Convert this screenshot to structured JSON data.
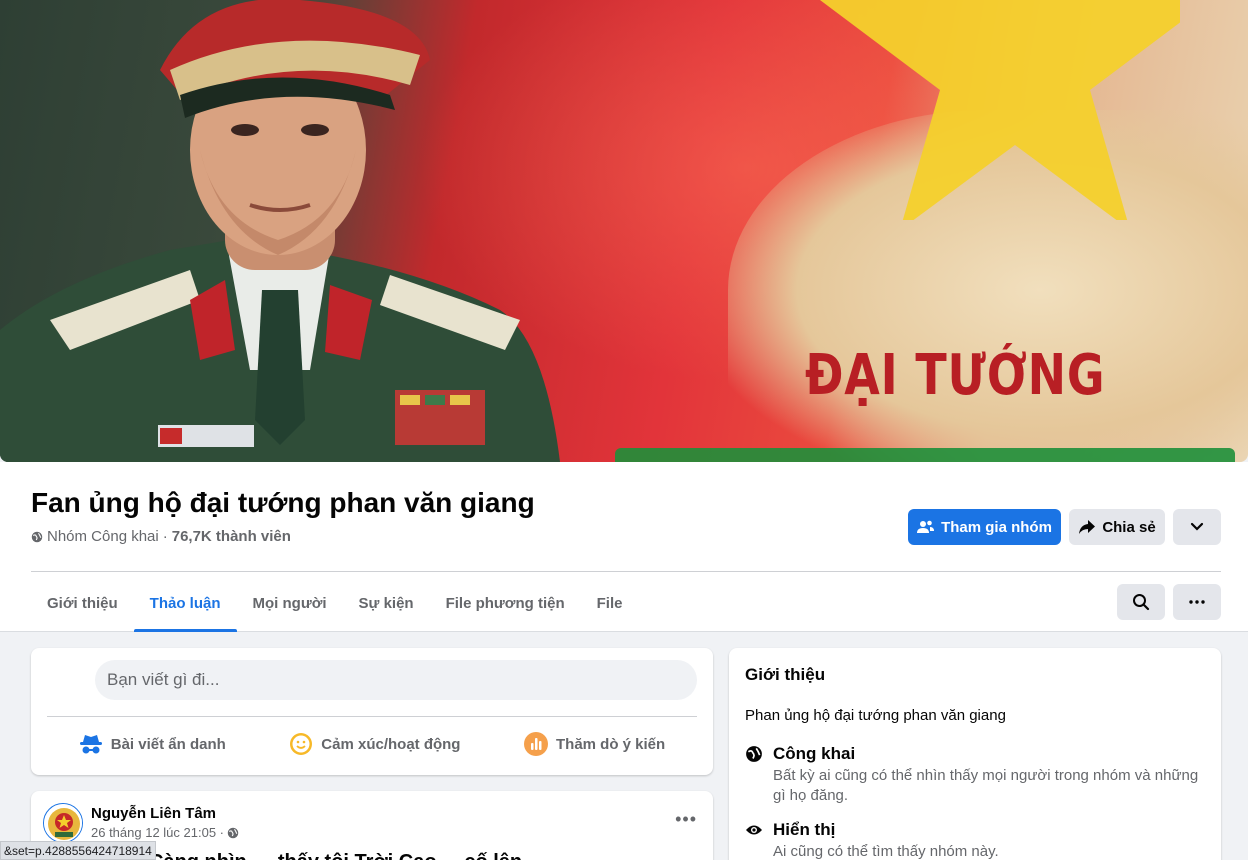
{
  "cover": {
    "text_line1": "ĐẠI TƯỚNG"
  },
  "group": {
    "title": "Fan ủng hộ đại tướng phan văn giang",
    "privacy": "Nhóm Công khai",
    "separator": "·",
    "members": "76,7K thành viên"
  },
  "actions": {
    "join_label": "Tham gia nhóm",
    "share_label": "Chia sẻ"
  },
  "tabs": [
    {
      "label": "Giới thiệu",
      "active": false
    },
    {
      "label": "Thảo luận",
      "active": true
    },
    {
      "label": "Mọi người",
      "active": false
    },
    {
      "label": "Sự kiện",
      "active": false
    },
    {
      "label": "File phương tiện",
      "active": false
    },
    {
      "label": "File",
      "active": false
    }
  ],
  "composer": {
    "placeholder": "Bạn viết gì đi...",
    "anonymous": "Bài viết ẩn danh",
    "feeling": "Cảm xúc/hoạt động",
    "poll": "Thăm dò ý kiến"
  },
  "post": {
    "author": "Nguyễn Liên Tâm",
    "time": "26 tháng 12 lúc 21:05 ·",
    "text": "Càng nhìn … thấy tôi Trời Cao ... cố lên"
  },
  "about": {
    "title": "Giới thiệu",
    "description": "Phan ủng hộ đại tướng phan văn giang",
    "public_title": "Công khai",
    "public_desc": "Bất kỳ ai cũng có thể nhìn thấy mọi người trong nhóm và những gì họ đăng.",
    "visible_title": "Hiển thị",
    "visible_desc": "Ai cũng có thể tìm thấy nhóm này."
  },
  "status_url": "&set=p.4288556424718914",
  "colors": {
    "accent": "#1b74e4",
    "secondary_text": "#65676b",
    "button_gray": "#e4e6eb",
    "page_bg": "#f0f2f5"
  }
}
